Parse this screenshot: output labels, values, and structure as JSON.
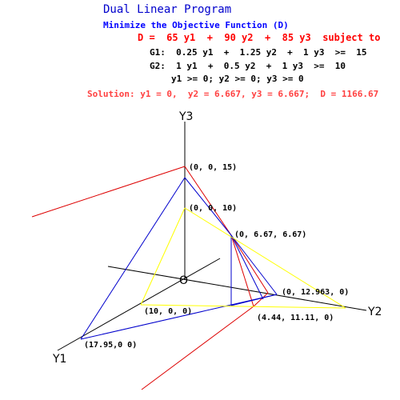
{
  "header": {
    "title": "Dual Linear Program",
    "subtitle": "Minimize the Objective Function (D)",
    "objective": "D =  65 y1  +  90 y2  +  85 y3  subject to",
    "constraints": [
      "G1:  0.25 y1  +  1.25 y2  +  1 y3  >=  15",
      "G2:  1 y1  +  0.5 y2  +  1 y3  >=  10",
      "y1 >= 0; y2 >= 0; y3 >= 0"
    ],
    "solution": "Solution: y1 = 0,  y2 = 6.667, y3 = 6.667;  D = 1166.67"
  },
  "colors": {
    "title": "#0000cc",
    "subtitle": "#0000ff",
    "objective": "#ff0000",
    "solution": "#ff4040",
    "constraint_g1_plane": "#0000cc",
    "constraint_g2_plane": "#ffff00",
    "objective_plane": "#dd0000",
    "axes": "#000000"
  },
  "diagram": {
    "axes": {
      "y1_label": "Y1",
      "y2_label": "Y2",
      "y3_label": "Y3",
      "origin_label": "O"
    },
    "point_labels": {
      "p_0_0_15": "(0, 0, 15)",
      "p_0_0_10": "(0, 0, 10)",
      "p_0_667_667": "(0, 6.67, 6.67)",
      "p_0_12963_0": "(0, 12.963, 0)",
      "p_10_0_0": "(10, 0, 0)",
      "p_444_1111_0": "(4.44, 11.11, 0)",
      "p_1795_0_0": "(17.95,0 0)"
    }
  }
}
